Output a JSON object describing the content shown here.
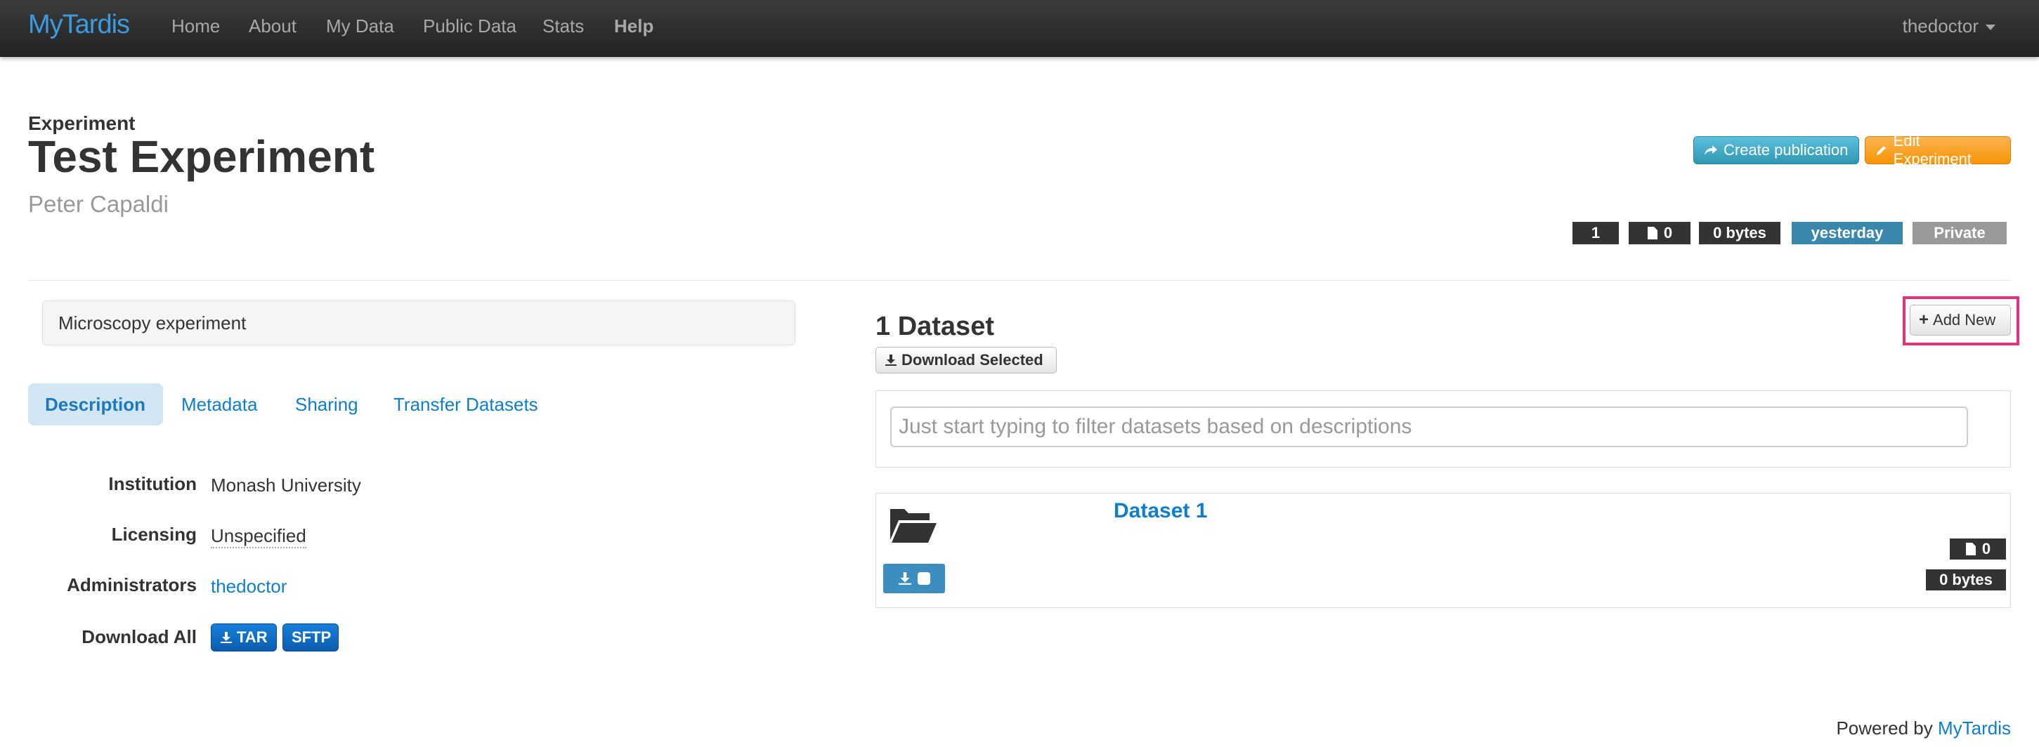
{
  "navbar": {
    "brand": "MyTardis",
    "items": [
      "Home",
      "About",
      "My Data",
      "Public Data",
      "Stats",
      "Help"
    ],
    "user": "thedoctor"
  },
  "header": {
    "kicker": "Experiment",
    "title": "Test Experiment",
    "author": "Peter Capaldi",
    "create_publication": "Create publication",
    "edit_experiment": "Edit Experiment"
  },
  "badges": {
    "datasets": "1",
    "files": "0",
    "size": "0 bytes",
    "date": "yesterday",
    "visibility": "Private"
  },
  "left": {
    "description_text": "Microscopy experiment",
    "tabs": [
      "Description",
      "Metadata",
      "Sharing",
      "Transfer Datasets"
    ],
    "details": {
      "institution_label": "Institution",
      "institution_value": "Monash University",
      "licensing_label": "Licensing",
      "licensing_value": "Unspecified",
      "admins_label": "Administrators",
      "admins_value": "thedoctor",
      "download_label": "Download All",
      "tar": "TAR",
      "sftp": "SFTP"
    }
  },
  "datasets": {
    "heading": "1 Dataset",
    "download_selected": "Download Selected",
    "add_new": "Add New",
    "filter_placeholder": "Just start typing to filter datasets based on descriptions",
    "items": [
      {
        "name": "Dataset 1",
        "file_count": "0",
        "size": "0 bytes"
      }
    ]
  },
  "footer": {
    "prefix": "Powered by ",
    "link": "MyTardis"
  },
  "colors": {
    "brand": "#3a9be0",
    "link": "#0d7ecd",
    "info": "#2f96b4",
    "warning": "#f89406",
    "badge_dark": "#333333",
    "badge_date": "#3a87ad",
    "badge_private": "#999999",
    "highlight": "#e0347b"
  }
}
